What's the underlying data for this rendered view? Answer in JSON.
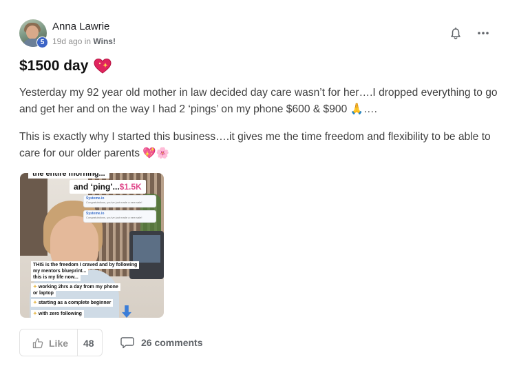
{
  "author": {
    "name": "Anna Lawrie",
    "level": "5",
    "time_ago": "19d ago",
    "in_word": "in",
    "category": "Wins!"
  },
  "post": {
    "title": "$1500 day",
    "paragraph1": "Yesterday my 92 year old mother in law decided day care wasn’t for her….I dropped everything to go and get her and on the way I had 2 ‘pings’ on my phone $600 & $900 🙏….",
    "paragraph2": "This is exactly why I started this business….it gives me the time freedom and flexibility to be able to care for our older parents 💖🌸"
  },
  "media": {
    "overlay_top": "the entire morning...",
    "ping_text": "and ‘ping’...",
    "ping_amount": "$1.5K",
    "notifications": [
      {
        "title": "Systeme.io",
        "line1": "Congratulations, you've just made a new sale!"
      },
      {
        "title": "Systeme.io",
        "line1": "Congratulations, you've just made a new sale!"
      }
    ],
    "captions": [
      "THIS is the freedom I craved and by following",
      "my mentors blueprint...",
      "this is my life now...",
      "working 2hrs a day from my phone",
      "or laptop",
      "starting as a complete beginner",
      "with zero following"
    ]
  },
  "actions": {
    "like_label": "Like",
    "like_count": "48",
    "comments_label": "26 comments"
  },
  "icons": {
    "bell": "bell-icon",
    "more": "more-horizontal-icon",
    "thumb": "thumbs-up-icon",
    "comment": "comment-icon",
    "title_emoji": "sparkling-heart-emoji"
  },
  "colors": {
    "level_badge": "#3c64c6",
    "ping_amount": "#e04a8c",
    "muted_text": "#909090"
  }
}
